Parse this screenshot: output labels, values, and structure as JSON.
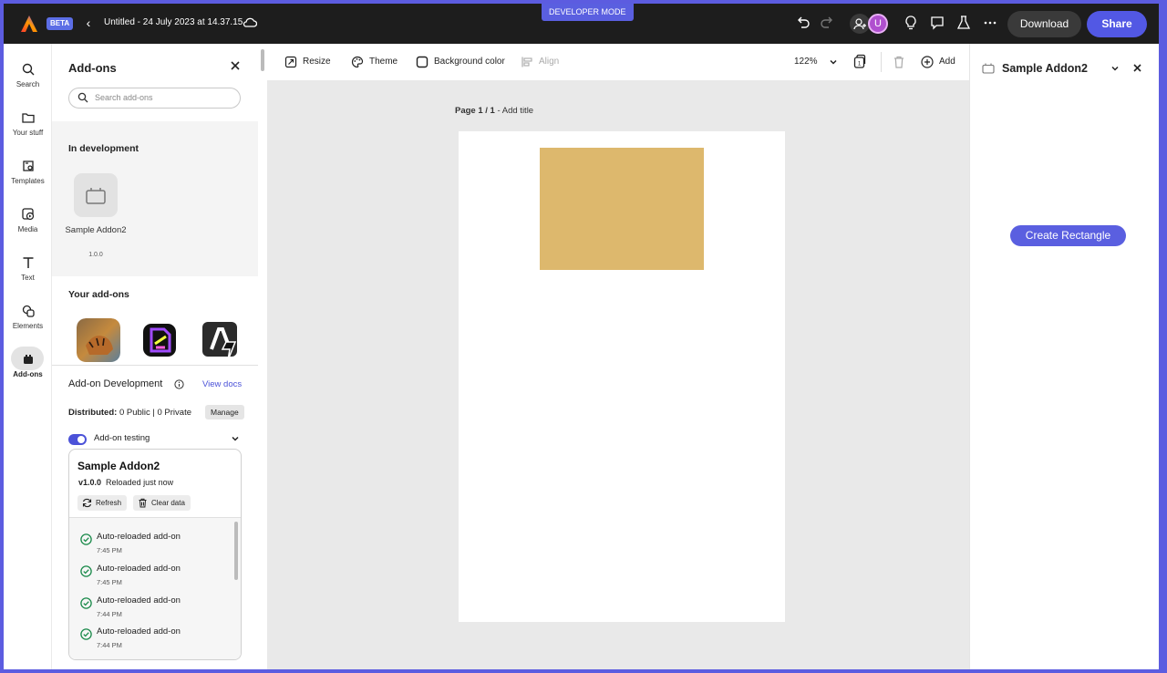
{
  "header": {
    "developer_mode": "DEVELOPER MODE",
    "beta": "BETA",
    "document_title": "Untitled - 24 July 2023 at 14.37.15",
    "download_label": "Download",
    "share_label": "Share",
    "avatar_initial": "U",
    "icons": [
      "adobe-express-logo-icon",
      "back-chevron-icon",
      "cloud-icon",
      "undo-icon",
      "redo-icon",
      "add-people-icon",
      "lightbulb-icon",
      "comment-icon",
      "flask-icon",
      "more-icon"
    ]
  },
  "rail": {
    "items": [
      {
        "label": "Search",
        "icon": "search-icon"
      },
      {
        "label": "Your stuff",
        "icon": "folder-icon"
      },
      {
        "label": "Templates",
        "icon": "templates-icon"
      },
      {
        "label": "Media",
        "icon": "media-icon"
      },
      {
        "label": "Text",
        "icon": "text-icon"
      },
      {
        "label": "Elements",
        "icon": "elements-icon"
      },
      {
        "label": "Add-ons",
        "icon": "addons-icon",
        "active": true
      }
    ]
  },
  "addons_panel": {
    "title": "Add-ons",
    "search_placeholder": "Search add-ons",
    "in_development_heading": "In development",
    "dev_addon": {
      "name": "Sample Addon2",
      "version": "1.0.0"
    },
    "your_addons_heading": "Your add-ons",
    "development": {
      "title": "Add-on Development",
      "view_docs": "View docs",
      "distributed_label": "Distributed:",
      "distributed_value": "0 Public | 0 Private",
      "manage_label": "Manage",
      "testing_label": "Add-on testing",
      "testing_enabled": true,
      "card": {
        "title": "Sample Addon2",
        "version": "v1.0.0",
        "status": "Reloaded just now",
        "refresh_label": "Refresh",
        "clear_label": "Clear data",
        "log": [
          {
            "text": "Auto-reloaded add-on",
            "time": "7:45 PM"
          },
          {
            "text": "Auto-reloaded add-on",
            "time": "7:45 PM"
          },
          {
            "text": "Auto-reloaded add-on",
            "time": "7:44 PM"
          },
          {
            "text": "Auto-reloaded add-on",
            "time": "7:44 PM"
          }
        ]
      }
    }
  },
  "toolbar": {
    "resize": "Resize",
    "theme": "Theme",
    "background_color": "Background color",
    "align": "Align",
    "zoom": "122%",
    "add": "Add"
  },
  "canvas": {
    "page_number": "Page 1 / 1",
    "add_title": "Add title",
    "rectangle_color": "#ddb86d",
    "background": "#e9e9e9"
  },
  "right_panel": {
    "title": "Sample Addon2",
    "create_button": "Create Rectangle"
  },
  "colors": {
    "accent": "#5258e4",
    "frame": "#5c5ce0",
    "topbar": "#1d1d1d",
    "success": "#1a8a4a"
  }
}
